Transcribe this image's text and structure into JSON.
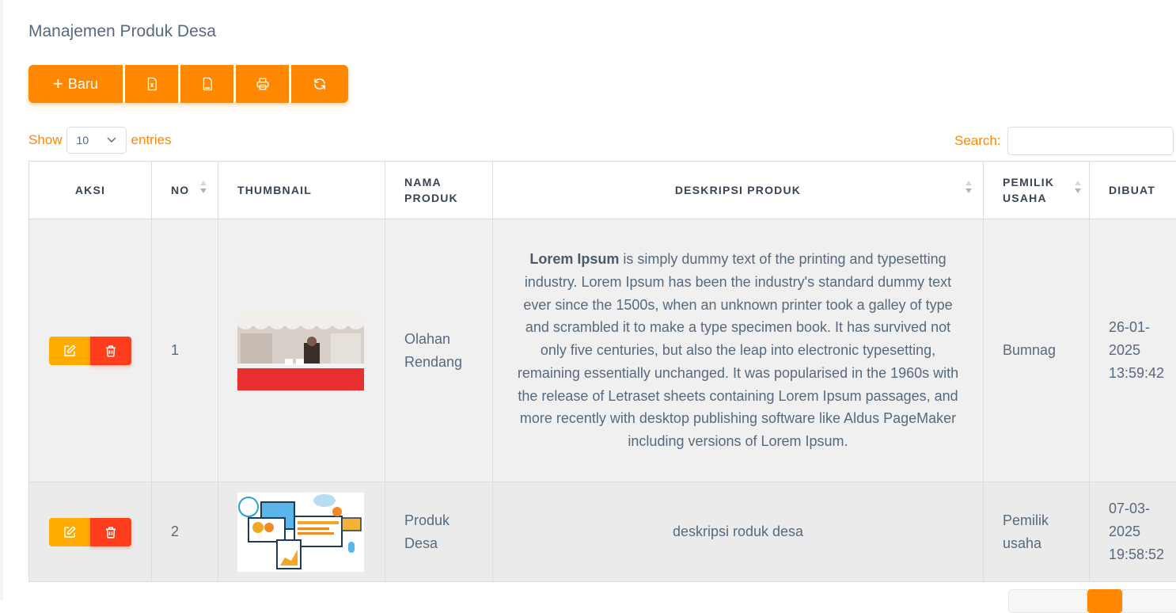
{
  "page": {
    "title": "Manajemen Produk Desa"
  },
  "toolbar": {
    "new_label": "Baru",
    "buttons": [
      {
        "icon": "excel-file-icon"
      },
      {
        "icon": "csv-file-icon"
      },
      {
        "icon": "printer-icon"
      },
      {
        "icon": "refresh-icon"
      }
    ],
    "accent": "#ff8800"
  },
  "length": {
    "show": "Show",
    "value": "10",
    "entries": "entries"
  },
  "search": {
    "label": "Search:",
    "value": ""
  },
  "table": {
    "headers": {
      "aksi": "AKSI",
      "no": "NO",
      "thumbnail": "THUMBNAIL",
      "nama_produk_1": "NAMA",
      "nama_produk_2": "PRODUK",
      "deskripsi": "DESKRIPSI PRODUK",
      "pemilik_1": "PEMILIK",
      "pemilik_2": "USAHA",
      "dibuat": "DIBUAT"
    },
    "rows": [
      {
        "no": "1",
        "thumbnail": "tent-booth-photo",
        "nama_1": "Olahan",
        "nama_2": "Rendang",
        "desc_bold": "Lorem Ipsum",
        "desc_rest": " is simply dummy text of the printing and typesetting industry. Lorem Ipsum has been the industry's standard dummy text ever since the 1500s, when an unknown printer took a galley of type and scrambled it to make a type specimen book. It has survived not only five centuries, but also the leap into electronic typesetting, remaining essentially unchanged. It was popularised in the 1960s with the release of Letraset sheets containing Lorem Ipsum passages, and more recently with desktop publishing software like Aldus PageMaker including versions of Lorem Ipsum.",
        "pemilik_1": "Bumnag",
        "pemilik_2": "",
        "dibuat_1": "26-01-",
        "dibuat_2": "2025",
        "dibuat_3": "13:59:42"
      },
      {
        "no": "2",
        "thumbnail": "web-illustration",
        "nama_1": "Produk",
        "nama_2": "Desa",
        "desc_bold": "",
        "desc_rest": "deskripsi roduk desa",
        "pemilik_1": "Pemilik",
        "pemilik_2": "usaha",
        "dibuat_1": "07-03-",
        "dibuat_2": "2025",
        "dibuat_3": "19:58:52"
      }
    ]
  },
  "pagination": {
    "active": ""
  }
}
